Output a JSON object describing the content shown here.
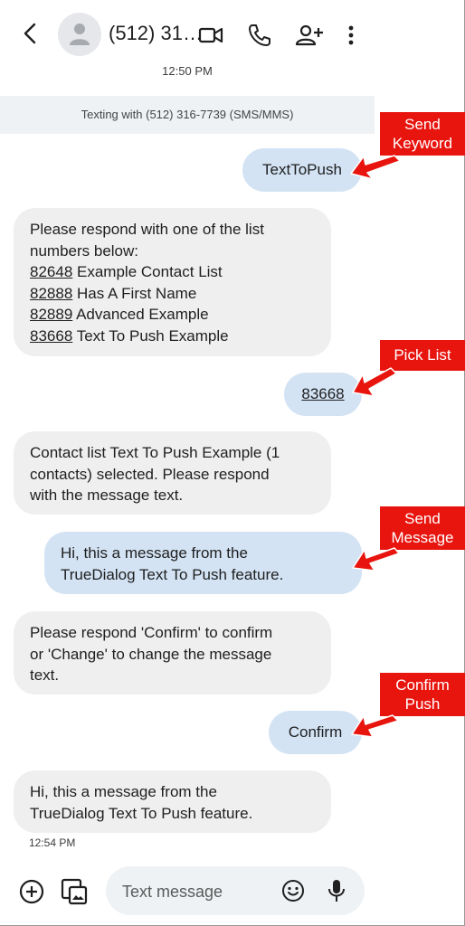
{
  "header": {
    "contact_name": "(512) 31…",
    "time": "12:50 PM"
  },
  "banner": "Texting with (512) 316-7739 (SMS/MMS)",
  "messages": {
    "m1": "TextToPush",
    "m2_intro_1": "Please respond with one of the list",
    "m2_intro_2": "numbers below:",
    "m2_items": [
      {
        "code": "82648",
        "name": "Example Contact List"
      },
      {
        "code": "82888",
        "name": "Has A First Name"
      },
      {
        "code": "82889",
        "name": "Advanced Example"
      },
      {
        "code": "83668",
        "name": "Text To Push Example"
      }
    ],
    "m3": "83668",
    "m4_lines": [
      "Contact list Text To Push Example (1",
      "contacts) selected. Please respond",
      "with the message text."
    ],
    "m5_lines": [
      "Hi, this a message from the",
      "TrueDialog Text To Push feature."
    ],
    "m6_lines": [
      "Please respond 'Confirm' to confirm",
      "or 'Change' to change the message",
      "text."
    ],
    "m7": "Confirm",
    "m8_lines": [
      "Hi, this a message from the",
      "TrueDialog Text To Push feature."
    ]
  },
  "bottom_time": "12:54 PM",
  "compose": {
    "placeholder": "Text message"
  },
  "annotations": {
    "a1": [
      "Send",
      "Keyword"
    ],
    "a2": [
      "Pick List"
    ],
    "a3": [
      "Send",
      "Message"
    ],
    "a4": [
      "Confirm",
      "Push"
    ]
  },
  "colors": {
    "outgoing_bubble": "#d3e3f4",
    "incoming_bubble": "#efefef",
    "annotation_red": "#e8140e"
  }
}
